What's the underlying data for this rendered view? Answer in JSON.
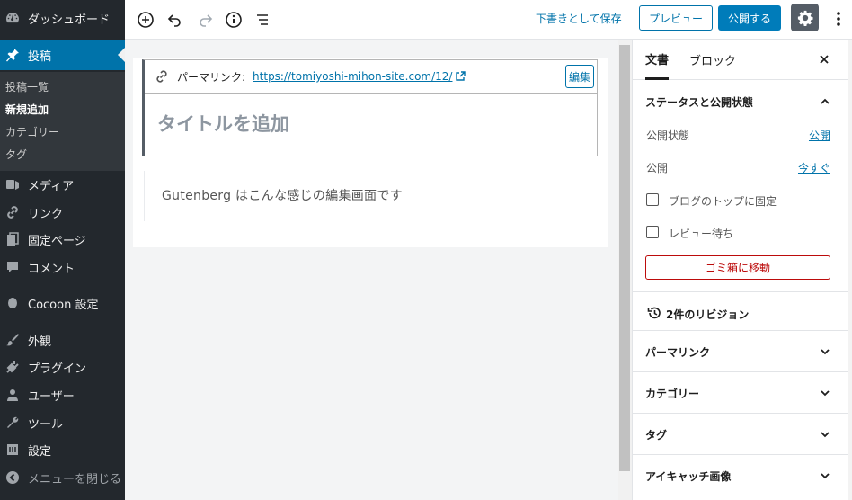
{
  "admin_menu": {
    "dashboard": "ダッシュボード",
    "posts": "投稿",
    "posts_sub": [
      "投稿一覧",
      "新規追加",
      "カテゴリー",
      "タグ"
    ],
    "media": "メディア",
    "links": "リンク",
    "pages": "固定ページ",
    "comments": "コメント",
    "cocoon": "Cocoon 設定",
    "appearance": "外観",
    "plugins": "プラグイン",
    "users": "ユーザー",
    "tools": "ツール",
    "settings": "設定",
    "collapse": "メニューを閉じる"
  },
  "toolbar": {
    "save_draft": "下書きとして保存",
    "preview": "プレビュー",
    "publish": "公開する"
  },
  "editor": {
    "permalink_label": "パーマリンク:",
    "permalink_url": "https://tomiyoshi-mihon-site.com/12/",
    "permalink_edit": "編集",
    "title_placeholder": "タイトルを追加",
    "paragraph": "Gutenberg はこんな感じの編集画面です"
  },
  "sidebar": {
    "tab_document": "文書",
    "tab_block": "ブロック",
    "status_panel": {
      "title": "ステータスと公開状態",
      "visibility_label": "公開状態",
      "visibility_value": "公開",
      "publish_label": "公開",
      "publish_value": "今すぐ",
      "stick_label": "ブログのトップに固定",
      "pending_label": "レビュー待ち",
      "trash": "ゴミ箱に移動"
    },
    "revisions": "2件のリビジョン",
    "panels": [
      "パーマリンク",
      "カテゴリー",
      "タグ",
      "アイキャッチ画像"
    ]
  },
  "colors": {
    "admin_bg": "#23282d",
    "admin_accent": "#0073aa",
    "primary_button": "#007cba",
    "trash_red": "#bc0b0b"
  }
}
